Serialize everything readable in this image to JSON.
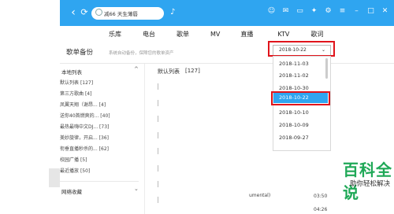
{
  "search": {
    "value": "减66 天生薄唇"
  },
  "tabs": [
    "乐库",
    "电台",
    "歌单",
    "MV",
    "直播",
    "KTV",
    "歌词"
  ],
  "backup": {
    "title": "歌单备份",
    "subtitle": "系统自动备份，保障您的歌单资产",
    "selected_date": "2018-10-22"
  },
  "sidebar": {
    "local_header": "本地列表",
    "items": [
      {
        "label": "默认列表",
        "count": "[127]"
      },
      {
        "label": "第三方歌曲",
        "count": "[4]"
      },
      {
        "label": "凤翼天翔（谢昂...",
        "count": "[4]"
      },
      {
        "label": "送你40首燃爽的...",
        "count": "[40]"
      },
      {
        "label": "最热最嗨中文DJ...",
        "count": "[73]"
      },
      {
        "label": "美妙旋律，开启...",
        "count": "[36]"
      },
      {
        "label": "衔垂直播秒杀的...",
        "count": "[62]"
      },
      {
        "label": "校园广播",
        "count": "[5]"
      },
      {
        "label": "最近播放",
        "count": "[50]"
      }
    ],
    "net_header": "网络收藏"
  },
  "list": {
    "title": "默认列表",
    "count": "[127]"
  },
  "fragments": {
    "frag1": "umental)",
    "time1": "03:50",
    "time2": "04:26"
  },
  "dropdown": {
    "dates": [
      "2018-11-03",
      "2018-11-02",
      "2018-10-30",
      "2018-10-22",
      "2018-10-10",
      "2018-10-09",
      "2018-09-27"
    ]
  },
  "watermark": {
    "title": "百科全说",
    "subtitle": "助你轻松解决"
  },
  "colors": {
    "accent": "#2fa5f0",
    "highlight": "#e0141b",
    "watermark": "#1fa857"
  }
}
